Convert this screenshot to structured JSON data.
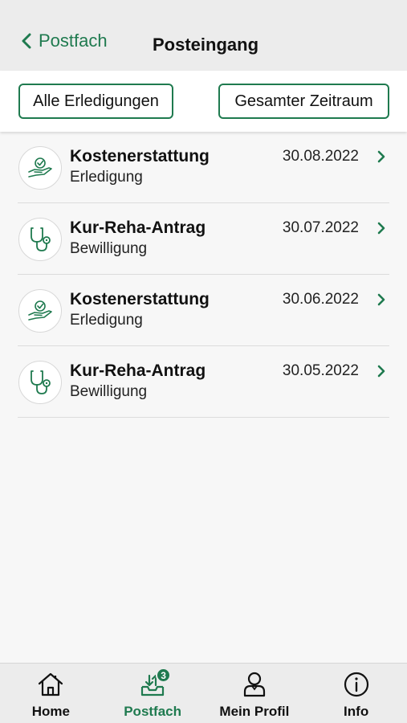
{
  "header": {
    "back_label": "Postfach",
    "title": "Posteingang"
  },
  "filters": {
    "type_label": "Alle Erledigungen",
    "period_label": "Gesamter Zeitraum"
  },
  "messages": [
    {
      "title": "Kostenerstattung",
      "subtitle": "Erledigung",
      "date": "30.08.2022",
      "icon": "hand-check-icon"
    },
    {
      "title": "Kur-Reha-Antrag",
      "subtitle": "Bewilligung",
      "date": "30.07.2022",
      "icon": "stethoscope-icon"
    },
    {
      "title": "Kostenerstattung",
      "subtitle": "Erledigung",
      "date": "30.06.2022",
      "icon": "hand-check-icon"
    },
    {
      "title": "Kur-Reha-Antrag",
      "subtitle": "Bewilligung",
      "date": "30.05.2022",
      "icon": "stethoscope-icon"
    }
  ],
  "nav": {
    "home_label": "Home",
    "postfach_label": "Postfach",
    "postfach_badge": "3",
    "profile_label": "Mein Profil",
    "info_label": "Info",
    "active": "Postfach"
  },
  "colors": {
    "accent": "#1f7a4f",
    "header_bg": "#ececec",
    "page_bg": "#f7f7f7"
  }
}
